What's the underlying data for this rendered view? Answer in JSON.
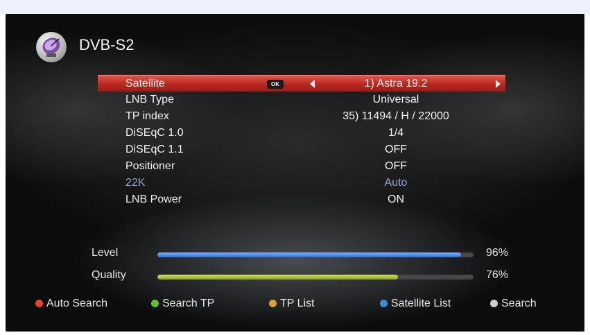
{
  "screen": {
    "title": "DVB-S2",
    "icon": "satellite-dish-icon"
  },
  "menu": {
    "rows": [
      {
        "label": "Satellite",
        "value": "1) Astra 19.2",
        "ok_badge": "OK",
        "selected": true
      },
      {
        "label": "LNB Type",
        "value": "Universal"
      },
      {
        "label": "TP index",
        "value": "35) 11494 / H / 22000"
      },
      {
        "label": "DiSEqC 1.0",
        "value": "1/4"
      },
      {
        "label": "DiSEqC 1.1",
        "value": "OFF"
      },
      {
        "label": "Positioner",
        "value": "OFF"
      },
      {
        "label": "22K",
        "value": "Auto",
        "accent": true
      },
      {
        "label": "LNB Power",
        "value": "ON"
      }
    ],
    "accent_color": "#8ea6d6",
    "selected_color": "#c0392b"
  },
  "signal": {
    "level": {
      "label": "Level",
      "percent_text": "96%",
      "value": 96,
      "color": "#3a7be0"
    },
    "quality": {
      "label": "Quality",
      "percent_text": "76%",
      "value": 76,
      "color": "#a3bd35"
    }
  },
  "footer": [
    {
      "label": "Auto Search",
      "color": "#e8442e"
    },
    {
      "label": "Search TP",
      "color": "#5bc236"
    },
    {
      "label": "TP List",
      "color": "#d9a33a"
    },
    {
      "label": "Satellite List",
      "color": "#3d8ad6"
    },
    {
      "label": "Search",
      "color": "#cfcfcf"
    }
  ]
}
